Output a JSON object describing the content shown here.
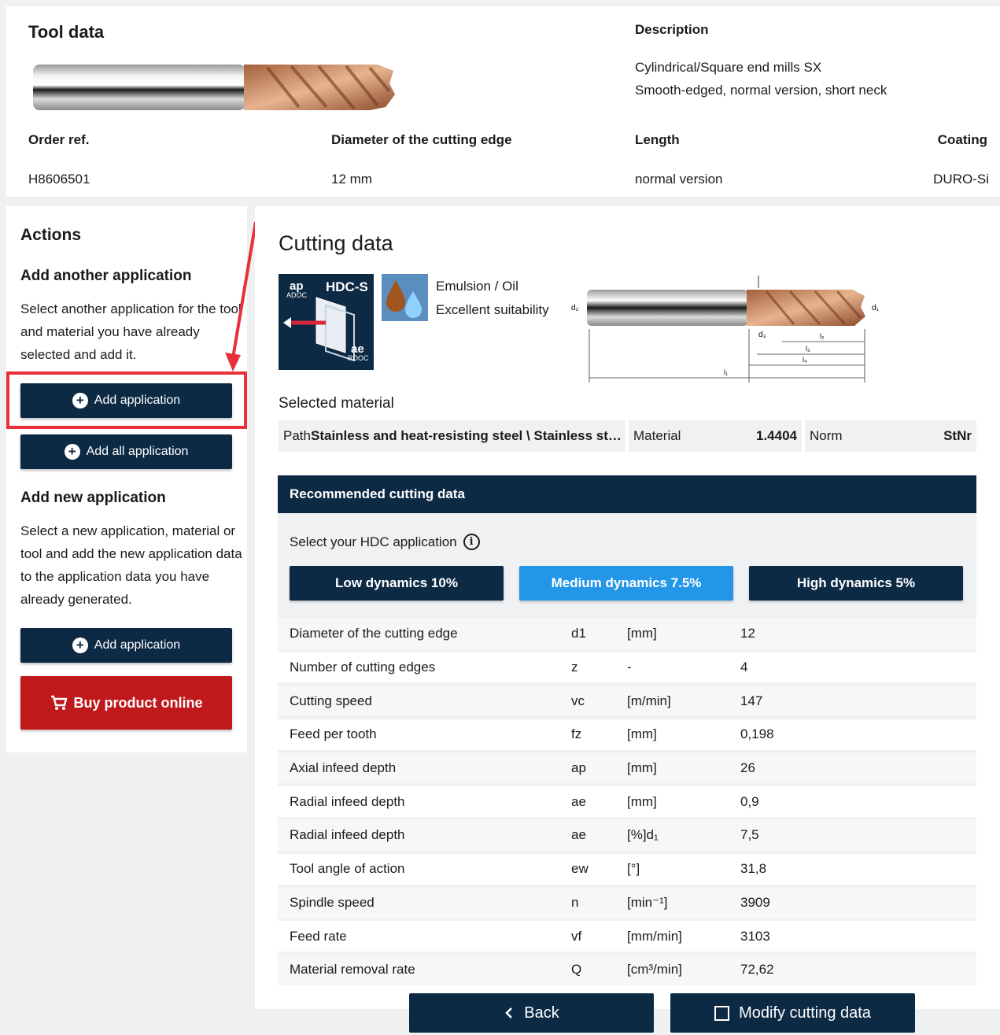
{
  "tool": {
    "title": "Tool data",
    "description_heading": "Description",
    "description_line1": "Cylindrical/Square end mills SX",
    "description_line2": "Smooth-edged, normal version, short neck",
    "specs": [
      {
        "label": "Order ref.",
        "value": "H8606501"
      },
      {
        "label": "Diameter of the cutting edge",
        "value": "12 mm"
      },
      {
        "label": "Length",
        "value": "normal version"
      },
      {
        "label": "Coating",
        "value": "DURO-Si"
      }
    ]
  },
  "actions": {
    "title": "Actions",
    "another_heading": "Add another application",
    "another_text": "Select another application for the tool and material you have already selected and add it.",
    "add_application_label": "Add application",
    "add_all_label": "Add all application",
    "new_heading": "Add new application",
    "new_text": "Select a new application, material or tool and add the new application data to the application data you have already generated.",
    "add_application_label_2": "Add application",
    "buy_label": "Buy product online"
  },
  "cutting": {
    "title": "Cutting data",
    "hdc_label": "HDC-S",
    "ap_label": "ap",
    "adoc_label": "ADOC",
    "ae_label": "ae",
    "rdoc_label": "RDOC",
    "coolant_line1": "Emulsion / Oil",
    "coolant_line2": "Excellent suitability",
    "diagram_labels": {
      "d2": "d₂",
      "d1": "d₁",
      "d3": "d₃",
      "l2": "l₂",
      "l3": "l₃",
      "l4": "l₄",
      "l1": "l₁"
    },
    "selected_material_heading": "Selected material",
    "material_path_prefix": "Path",
    "material_path": "Stainless and heat-resisting steel \\ Stainless st…",
    "material_label": "Material",
    "material_value": "1.4404",
    "norm_label": "Norm",
    "norm_value": "StNr",
    "recommended_heading": "Recommended cutting data",
    "select_hdc_label": "Select your HDC application",
    "dynamics": [
      {
        "label": "Low dynamics 10%",
        "active": false
      },
      {
        "label": "Medium dynamics 7.5%",
        "active": true
      },
      {
        "label": "High dynamics 5%",
        "active": false
      }
    ],
    "rows": [
      {
        "name": "Diameter of the cutting edge",
        "symbol": "d1",
        "unit": "[mm]",
        "value": "12"
      },
      {
        "name": "Number of cutting edges",
        "symbol": "z",
        "unit": "-",
        "value": "4"
      },
      {
        "name": "Cutting speed",
        "symbol": "vc",
        "unit": "[m/min]",
        "value": "147"
      },
      {
        "name": "Feed per tooth",
        "symbol": "fz",
        "unit": "[mm]",
        "value": "0,198"
      },
      {
        "name": "Axial infeed depth",
        "symbol": "ap",
        "unit": "[mm]",
        "value": "26"
      },
      {
        "name": "Radial infeed depth",
        "symbol": "ae",
        "unit": "[mm]",
        "value": "0,9"
      },
      {
        "name": "Radial infeed depth",
        "symbol": "ae",
        "unit": "[%]d₁",
        "value": "7,5"
      },
      {
        "name": "Tool angle of action",
        "symbol": "ew",
        "unit": "[°]",
        "value": "31,8"
      },
      {
        "name": "Spindle speed",
        "symbol": "n",
        "unit": "[min⁻¹]",
        "value": "3909"
      },
      {
        "name": "Feed rate",
        "symbol": "vf",
        "unit": "[mm/min]",
        "value": "3103"
      },
      {
        "name": "Material removal rate",
        "symbol": "Q",
        "unit": "[cm³/min]",
        "value": "72,62"
      }
    ]
  },
  "footer": {
    "back_label": "Back",
    "modify_label": "Modify cutting data"
  },
  "colors": {
    "navy": "#0d2a45",
    "active_blue": "#2496e8",
    "buy_red": "#c0191c",
    "highlight": "#e8313a"
  }
}
